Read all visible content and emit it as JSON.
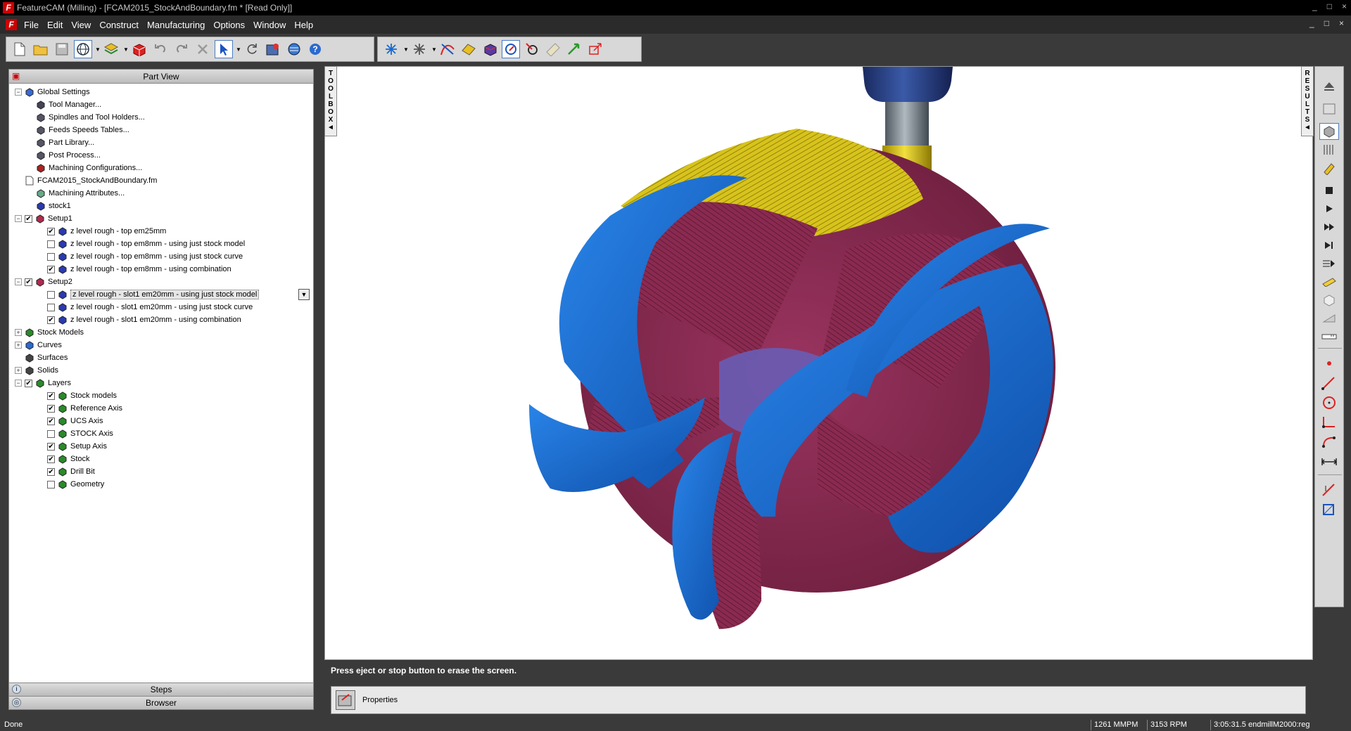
{
  "window": {
    "title": "FeatureCAM (Milling) - [FCAM2015_StockAndBoundary.fm * [Read Only]]",
    "controls": [
      "_",
      "□",
      "×"
    ]
  },
  "menu": {
    "items": [
      "File",
      "Edit",
      "View",
      "Construct",
      "Manufacturing",
      "Options",
      "Window",
      "Help"
    ],
    "mdi_controls": [
      "_",
      "□",
      "×"
    ]
  },
  "toolbar": {
    "icons": [
      "new-file-icon",
      "open-folder-icon",
      "save-icon",
      "globe-icon",
      "layers-icon",
      "stock-icon",
      "undo-icon",
      "redo-icon",
      "delete-icon",
      "select-arrow-icon",
      "rotate-icon",
      "wizard-icon",
      "help-globe-icon",
      "help-icon",
      "snap-icon",
      "tools-icon",
      "curve-icon",
      "surface-icon",
      "solid-icon",
      "simulate-icon",
      "circle-icon",
      "ruler-icon",
      "move-icon",
      "scale-icon"
    ]
  },
  "left_panel": {
    "header": "Part View",
    "tree": [
      {
        "label": "Global Settings",
        "expander": "−",
        "icon": "globe-settings-icon",
        "indent": 0
      },
      {
        "label": "Tool Manager...",
        "icon": "tool-manager-icon",
        "indent": 1
      },
      {
        "label": "Spindles and Tool Holders...",
        "icon": "spindle-icon",
        "indent": 1
      },
      {
        "label": "Feeds  Speeds Tables...",
        "icon": "feeds-icon",
        "indent": 1
      },
      {
        "label": "Part Library...",
        "icon": "library-icon",
        "indent": 1
      },
      {
        "label": "Post Process...",
        "icon": "post-process-icon",
        "indent": 1
      },
      {
        "label": "Machining Configurations...",
        "icon": "machine-config-icon",
        "indent": 1
      },
      {
        "label": "FCAM2015_StockAndBoundary.fm",
        "icon": "document-icon",
        "indent": 0
      },
      {
        "label": "Machining Attributes...",
        "icon": "attributes-icon",
        "indent": 1
      },
      {
        "label": "stock1",
        "icon": "stock-icon",
        "indent": 1
      },
      {
        "label": "Setup1",
        "expander": "−",
        "checkbox": "✔",
        "icon": "setup-icon",
        "indent": 0
      },
      {
        "label": "z level rough - top em25mm",
        "checkbox": "✔",
        "icon": "operation-icon",
        "indent": 2
      },
      {
        "label": "z level rough - top em8mm - using just stock model",
        "checkbox": "",
        "icon": "operation-icon",
        "indent": 2
      },
      {
        "label": "z level rough - top em8mm - using just stock curve",
        "checkbox": "",
        "icon": "operation-icon",
        "indent": 2
      },
      {
        "label": "z level rough - top em8mm - using combination",
        "checkbox": "✔",
        "icon": "operation-icon",
        "indent": 2
      },
      {
        "label": "Setup2",
        "expander": "−",
        "checkbox": "✔",
        "icon": "setup-icon",
        "indent": 0
      },
      {
        "label": "z level rough - slot1 em20mm - using just stock model",
        "checkbox": "",
        "icon": "operation-icon",
        "indent": 2,
        "selected": true
      },
      {
        "label": "z level rough - slot1 em20mm - using just stock curve",
        "checkbox": "",
        "icon": "operation-icon",
        "indent": 2
      },
      {
        "label": "z level rough - slot1 em20mm - using combination",
        "checkbox": "✔",
        "icon": "operation-icon",
        "indent": 2
      },
      {
        "label": "Stock Models",
        "expander": "+",
        "icon": "stock-models-icon",
        "indent": 0
      },
      {
        "label": "Curves",
        "expander": "+",
        "icon": "curves-icon",
        "indent": 0
      },
      {
        "label": "Surfaces",
        "icon": "surfaces-icon",
        "indent": 0
      },
      {
        "label": "Solids",
        "expander": "+",
        "icon": "solids-icon",
        "indent": 0
      },
      {
        "label": "Layers",
        "expander": "−",
        "checkbox": "✔",
        "icon": "layers-icon",
        "indent": 0
      },
      {
        "label": "Stock models",
        "checkbox": "✔",
        "icon": "layer-icon",
        "indent": 2
      },
      {
        "label": "Reference Axis",
        "checkbox": "✔",
        "icon": "layer-icon",
        "indent": 2
      },
      {
        "label": "UCS Axis",
        "checkbox": "✔",
        "icon": "layer-icon",
        "indent": 2
      },
      {
        "label": "STOCK Axis",
        "checkbox": "",
        "icon": "layer-icon",
        "indent": 2
      },
      {
        "label": "Setup Axis",
        "checkbox": "✔",
        "icon": "layer-icon",
        "indent": 2
      },
      {
        "label": "Stock",
        "checkbox": "✔",
        "icon": "layer-icon",
        "indent": 2
      },
      {
        "label": "Drill Bit",
        "checkbox": "✔",
        "icon": "layer-icon",
        "indent": 2
      },
      {
        "label": "Geometry",
        "checkbox": "",
        "icon": "layer-icon",
        "indent": 2
      }
    ],
    "dropdown_glyph": "▼",
    "footer_steps": "Steps",
    "footer_browser": "Browser"
  },
  "toolbox": {
    "letters": [
      "T",
      "O",
      "O",
      "L",
      "B",
      "O",
      "X",
      "◄"
    ]
  },
  "results": {
    "letters": [
      "R",
      "E",
      "S",
      "U",
      "L",
      "T",
      "S",
      "◄"
    ]
  },
  "right_toolbar": {
    "icons": [
      "eject-icon",
      "home-view-icon",
      "solid-view-icon",
      "toolpath-view-icon",
      "dimension-view-icon",
      "stop-icon",
      "play-icon",
      "step-forward-icon",
      "fast-forward-icon",
      "end-icon",
      "step-options-icon",
      "tool-display-icon",
      "shade-icon",
      "render-icon",
      "ruler-icon",
      "point-icon",
      "line-icon",
      "circle-icon",
      "corner-icon",
      "arc-icon",
      "measure-icon",
      "trim-icon",
      "select-box-icon"
    ]
  },
  "message": {
    "text": "Press eject or stop button to erase the screen.",
    "properties_label": "Properties"
  },
  "status": {
    "left": "Done",
    "feed": "1261 MMPM",
    "speed": "3153 RPM",
    "time": "3:05:31.5",
    "tool": "endmillM2000:reg"
  },
  "colors": {
    "part_blue": "#1e6fd0",
    "stock_maroon": "#8a2a4e",
    "cut_yellow": "#d7c31c",
    "floor_purple": "#6a5bb0",
    "tool_dark_blue": "#233a7a",
    "shank_gray": "#808890"
  }
}
